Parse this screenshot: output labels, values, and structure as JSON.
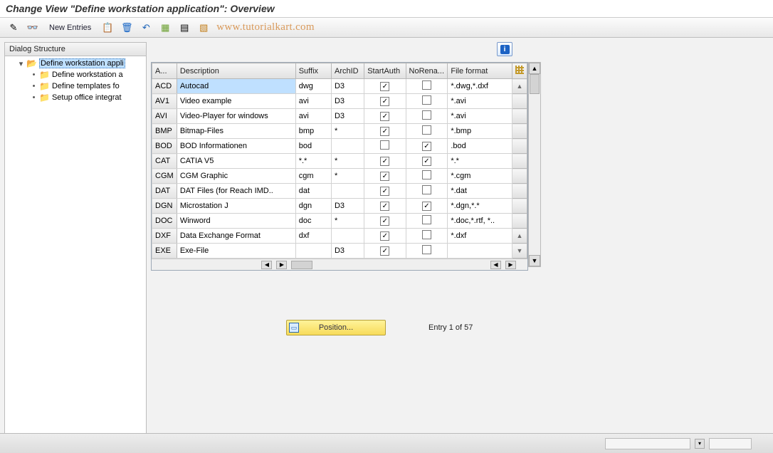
{
  "title": "Change View \"Define workstation application\": Overview",
  "toolbar": {
    "new_entries": "New Entries"
  },
  "watermark": "www.tutorialkart.com",
  "tree": {
    "header": "Dialog Structure",
    "root": "Define workstation appli",
    "children": [
      "Define workstation a",
      "Define templates fo",
      "Setup office integrat"
    ]
  },
  "columns": {
    "a": "A...",
    "desc": "Description",
    "suffix": "Suffix",
    "arch": "ArchID",
    "start": "StartAuth",
    "noren": "NoRena...",
    "ff": "File format"
  },
  "rows": [
    {
      "a": "ACD",
      "desc": "Autocad",
      "suffix": "dwg",
      "arch": "D3",
      "start": true,
      "noren": false,
      "ff": "*.dwg,*.dxf"
    },
    {
      "a": "AV1",
      "desc": "Video example",
      "suffix": "avi",
      "arch": "D3",
      "start": true,
      "noren": false,
      "ff": "*.avi"
    },
    {
      "a": "AVI",
      "desc": "Video-Player for windows",
      "suffix": "avi",
      "arch": "D3",
      "start": true,
      "noren": false,
      "ff": "*.avi"
    },
    {
      "a": "BMP",
      "desc": "Bitmap-Files",
      "suffix": "bmp",
      "arch": "*",
      "start": true,
      "noren": false,
      "ff": "*.bmp"
    },
    {
      "a": "BOD",
      "desc": "BOD Informationen",
      "suffix": "bod",
      "arch": "",
      "start": false,
      "noren": true,
      "ff": ".bod"
    },
    {
      "a": "CAT",
      "desc": "CATIA V5",
      "suffix": "*.*",
      "arch": "*",
      "start": true,
      "noren": true,
      "ff": "*.*"
    },
    {
      "a": "CGM",
      "desc": "CGM Graphic",
      "suffix": "cgm",
      "arch": "*",
      "start": true,
      "noren": false,
      "ff": "*.cgm"
    },
    {
      "a": "DAT",
      "desc": "DAT Files (for Reach IMD..",
      "suffix": "dat",
      "arch": "",
      "start": true,
      "noren": false,
      "ff": "*.dat"
    },
    {
      "a": "DGN",
      "desc": "Microstation J",
      "suffix": "dgn",
      "arch": "D3",
      "start": true,
      "noren": true,
      "ff": "*.dgn,*.*"
    },
    {
      "a": "DOC",
      "desc": "Winword",
      "suffix": "doc",
      "arch": "*",
      "start": true,
      "noren": false,
      "ff": "*.doc,*.rtf, *.."
    },
    {
      "a": "DXF",
      "desc": "Data Exchange Format",
      "suffix": "dxf",
      "arch": "",
      "start": true,
      "noren": false,
      "ff": "*.dxf"
    },
    {
      "a": "EXE",
      "desc": "Exe-File",
      "suffix": "",
      "arch": "D3",
      "start": true,
      "noren": false,
      "ff": ""
    }
  ],
  "position_label": "Position...",
  "entry_text": "Entry 1 of 57"
}
